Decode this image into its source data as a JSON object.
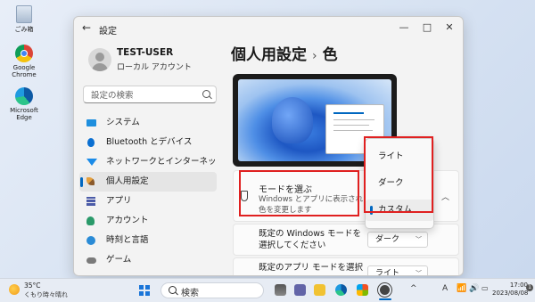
{
  "desktop": {
    "icons": [
      {
        "label": "ごみ箱",
        "icon": "recycle-bin-icon"
      },
      {
        "label": "Google Chrome",
        "icon": "chrome-icon"
      },
      {
        "label": "Microsoft Edge",
        "icon": "edge-icon"
      }
    ]
  },
  "window": {
    "title": "設定",
    "controls": {
      "minimize": "—",
      "maximize": "□",
      "close": "✕"
    }
  },
  "user": {
    "name": "TEST-USER",
    "account_type": "ローカル アカウント"
  },
  "search": {
    "placeholder": "設定の検索"
  },
  "sidebar": {
    "items": [
      {
        "label": "システム",
        "icon": "system-icon"
      },
      {
        "label": "Bluetooth とデバイス",
        "icon": "bluetooth-icon"
      },
      {
        "label": "ネットワークとインターネット",
        "icon": "network-icon"
      },
      {
        "label": "個人用設定",
        "icon": "personalization-icon",
        "active": true
      },
      {
        "label": "アプリ",
        "icon": "apps-icon"
      },
      {
        "label": "アカウント",
        "icon": "account-icon"
      },
      {
        "label": "時刻と言語",
        "icon": "time-language-icon"
      },
      {
        "label": "ゲーム",
        "icon": "gaming-icon"
      }
    ]
  },
  "main": {
    "breadcrumb_parent": "個人用設定",
    "breadcrumb_separator": "›",
    "page_title": "色",
    "mode_card": {
      "title": "モードを選ぶ",
      "description": "Windows とアプリに表示される色を変更します",
      "icon": "brush-icon"
    },
    "mode_dropdown": {
      "options": [
        "ライト",
        "ダーク",
        "カスタム"
      ],
      "selected": "カスタム"
    },
    "windows_mode_row": {
      "label": "既定の Windows モードを選択してください",
      "value": "ダーク"
    },
    "app_mode_row": {
      "label": "既定のアプリ モードを選択",
      "value": "ライト"
    }
  },
  "taskbar": {
    "weather": {
      "temp": "35°C",
      "desc": "くもり時々晴れ"
    },
    "search_label": "検索",
    "tray": {
      "chevron": "^",
      "ime": "A",
      "wifi": "📶",
      "volume": "🔊",
      "battery": "▭"
    },
    "clock": {
      "time": "17:00",
      "date": "2023/08/08"
    },
    "notifications": "1"
  },
  "colors": {
    "accent": "#0067c0",
    "highlight": "#e02020",
    "window_bg": "#f3f3f3"
  }
}
